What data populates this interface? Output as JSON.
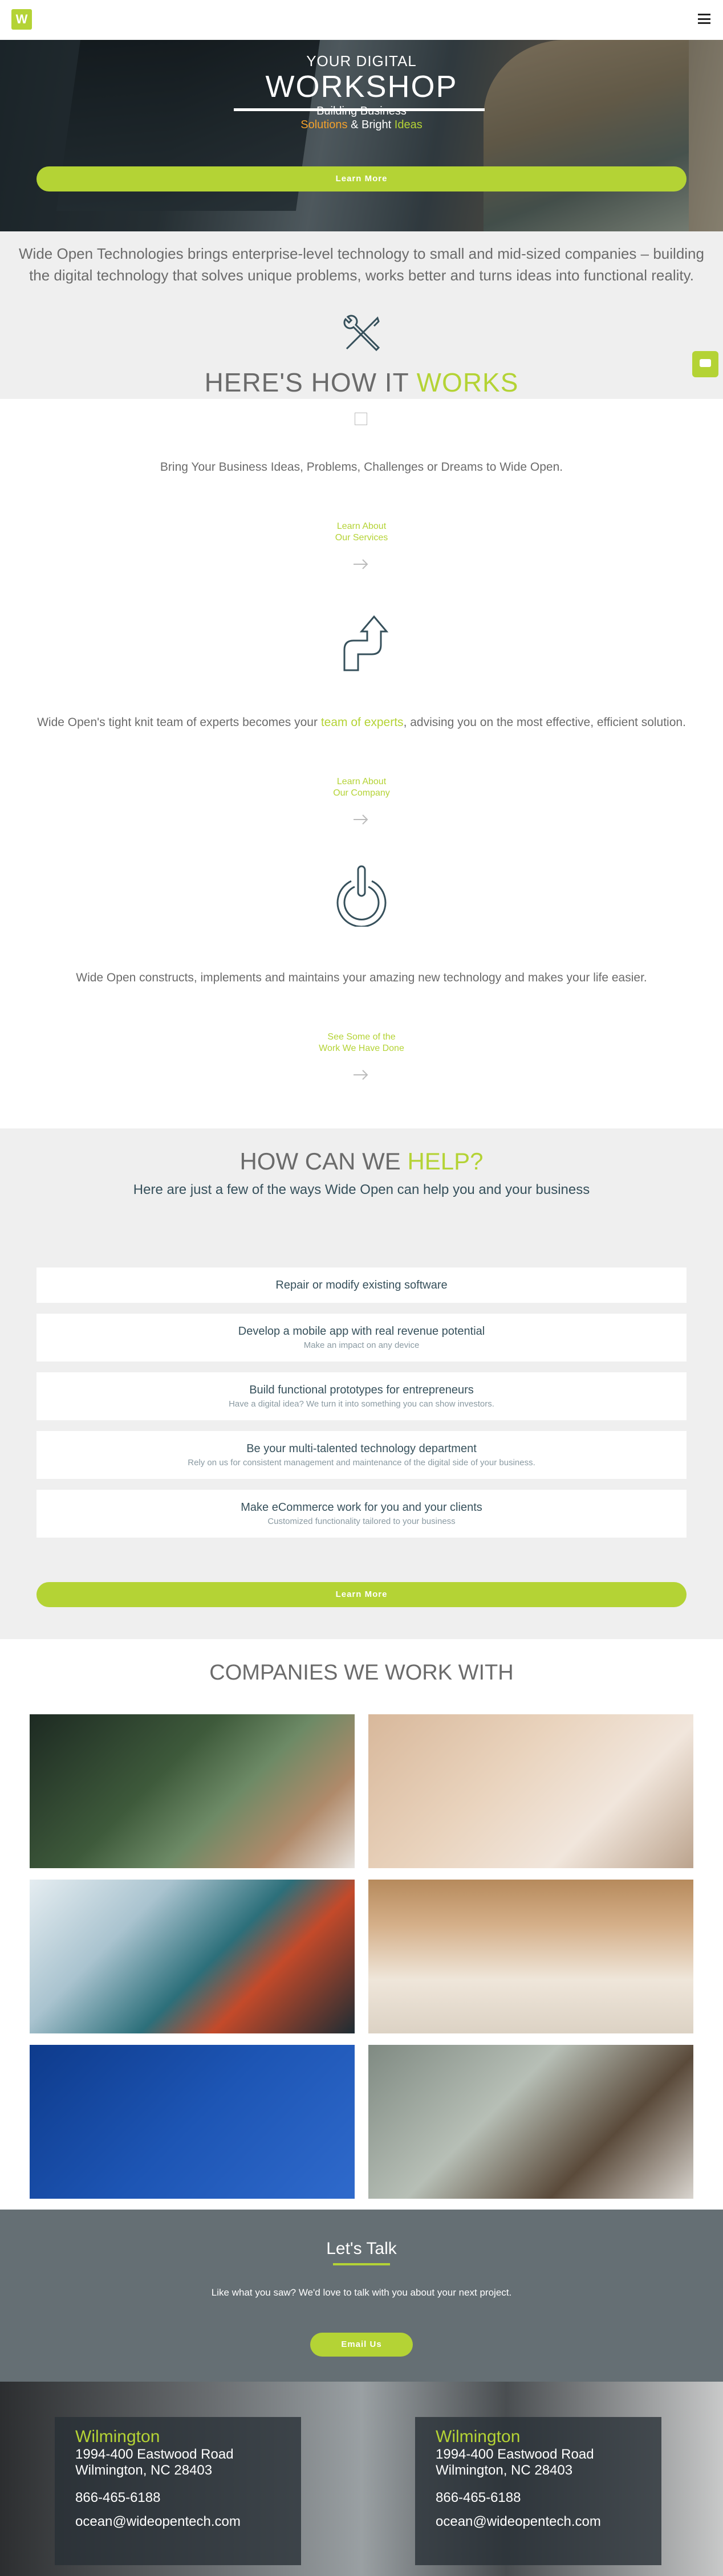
{
  "header": {
    "logo_letter": "W",
    "menu_icon": "hamburger-menu-icon"
  },
  "hero": {
    "kicker": "YOUR DIGITAL",
    "title": "WORKSHOP",
    "sub1": "Building Business",
    "sub2_a": "Solutions",
    "sub2_b": " & Bright ",
    "sub2_c": "Ideas",
    "cta": "Learn More"
  },
  "intro": {
    "text": "Wide Open Technologies brings enterprise-level technology to small and mid-sized companies – building the digital technology that solves unique problems, works better and turns ideas into functional reality.",
    "heading_a": "HERE'S HOW IT ",
    "heading_b": "WORKS"
  },
  "steps": {
    "s1_text": "Bring Your Business Ideas, Problems, Challenges or Dreams to Wide Open.",
    "s1_link_1": "Learn About",
    "s1_link_2": "Our Services",
    "s2_text_a": "Wide Open's tight knit team of experts becomes your ",
    "s2_text_link": "team of experts",
    "s2_text_b": ", advising you on the most effective, efficient solution.",
    "s2_link_1": "Learn About",
    "s2_link_2": "Our Company",
    "s3_text": "Wide Open constructs, implements and maintains your amazing new technology and makes your life easier.",
    "s3_link_1": "See Some of the",
    "s3_link_2": "Work We Have Done"
  },
  "help": {
    "title_a": "HOW CAN WE ",
    "title_b": "HELP?",
    "subtitle": "Here are just a few of the ways Wide Open can help you and your business",
    "items": [
      {
        "title": "Repair or modify existing software",
        "desc": ""
      },
      {
        "title": "Develop a mobile app with real revenue potential",
        "desc": "Make an impact on any device"
      },
      {
        "title": "Build functional prototypes for entrepreneurs",
        "desc": "Have a digital idea? We turn it into something you can show investors."
      },
      {
        "title": "Be your multi-talented technology department",
        "desc": "Rely on us for consistent management and maintenance of the digital side of your business."
      },
      {
        "title": "Make eCommerce work for you and your clients",
        "desc": "Customized functionality tailored to your business"
      }
    ],
    "cta": "Learn More"
  },
  "companies": {
    "title": "COMPANIES WE WORK WITH"
  },
  "talk": {
    "title": "Let's Talk",
    "text": "Like what you saw? We'd love to talk with you about your next project.",
    "cta": "Email Us"
  },
  "offices": [
    {
      "city": "Wilmington",
      "line1": "1994-400 Eastwood Road",
      "line2": "Wilmington, NC 28403",
      "phone": "866-465-6188",
      "email": "ocean@wideopentech.com"
    },
    {
      "city": "Wilmington",
      "line1": "1994-400 Eastwood Road",
      "line2": "Wilmington, NC 28403",
      "phone": "866-465-6188",
      "email": "ocean@wideopentech.com"
    }
  ],
  "colors": {
    "accent": "#b4d335",
    "orange": "#f3a12b",
    "dark_text": "#36505b",
    "talk_bg": "#656f74"
  }
}
